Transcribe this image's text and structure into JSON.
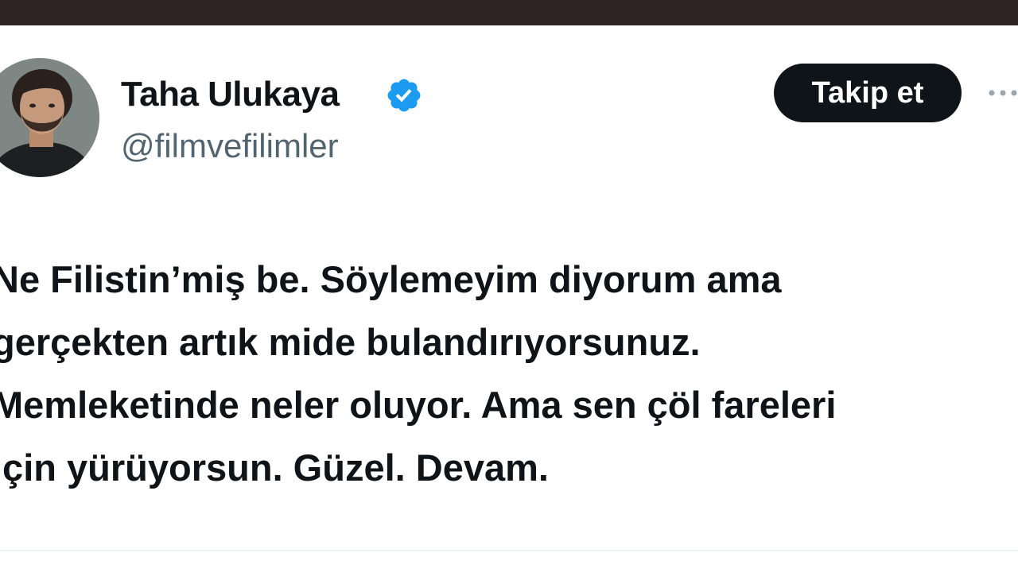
{
  "tweet": {
    "author": {
      "name": "Taha Ulukaya",
      "handle": "@filmvefilimler",
      "verified": true
    },
    "follow_label": "Takip et",
    "more_icon": "more-horizontal-icon",
    "text": "Ne Filistin’miş be. Söylemeyim diyorum ama\ngerçekten artık mide bulandırıyorsunuz.\nMemleketinde neler oluyor. Ama sen çöl fareleri\niçin yürüyorsun. Güzel. Devam."
  },
  "colors": {
    "top_bar": "#2e2423",
    "text_primary": "#0f1419",
    "text_secondary": "#536471",
    "verified_badge": "#1d9bf0",
    "button_bg": "#0f1419",
    "button_text": "#ffffff"
  }
}
